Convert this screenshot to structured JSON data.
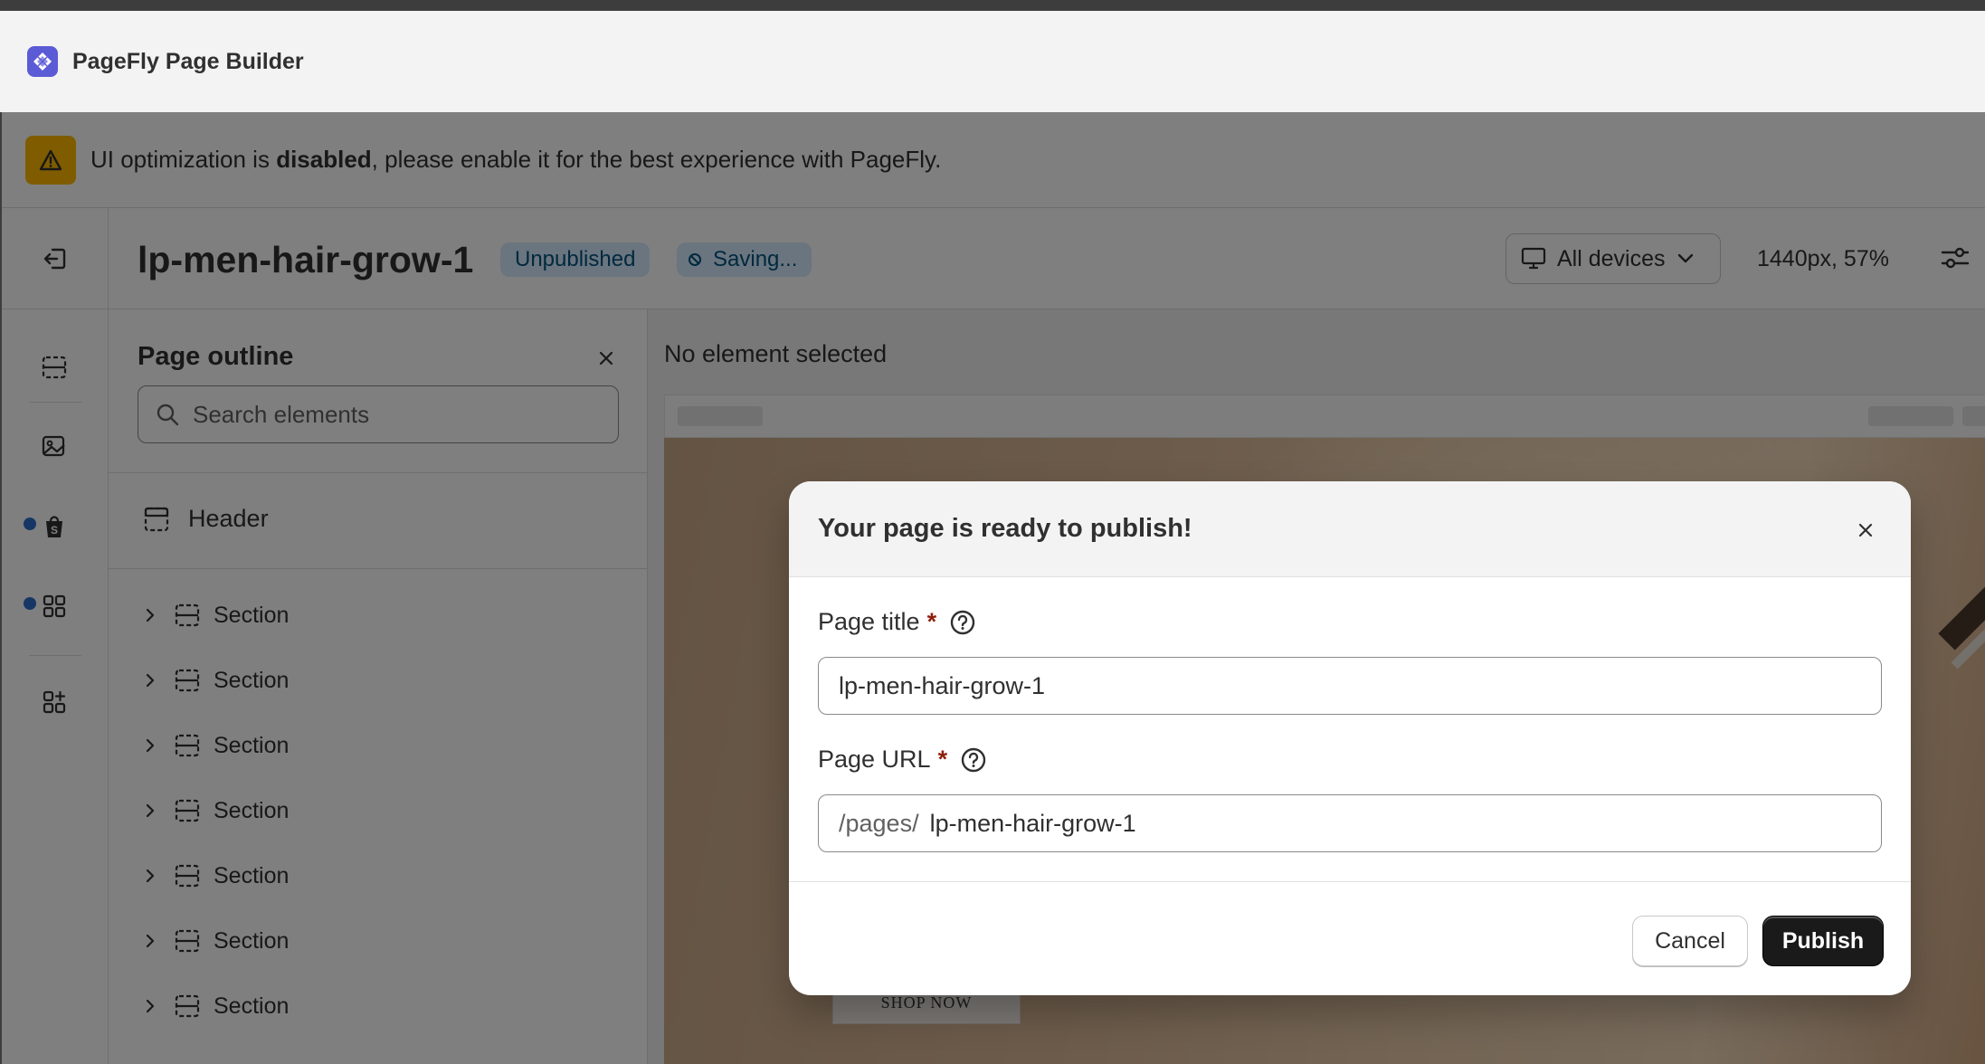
{
  "app": {
    "title": "PageFly Page Builder",
    "logo_icon": "pagefly-logo-icon"
  },
  "warning": {
    "text_before": "UI optimization is ",
    "text_bold": "disabled",
    "text_after": ", please enable it for the best experience with PageFly."
  },
  "header": {
    "page_name": "lp-men-hair-grow-1",
    "status_badge": "Unpublished",
    "saving_badge": "Saving...",
    "device_selector": "All devices",
    "zoom": "1440px, 57%"
  },
  "outline": {
    "title": "Page outline",
    "search_placeholder": "Search elements",
    "header_item": "Header",
    "sections": [
      "Section",
      "Section",
      "Section",
      "Section",
      "Section",
      "Section",
      "Section"
    ]
  },
  "canvas": {
    "no_selection": "No element selected",
    "shop_button": "SHOP NOW"
  },
  "modal": {
    "title": "Your page is ready to publish!",
    "page_title_label": "Page title",
    "page_title_value": "lp-men-hair-grow-1",
    "page_url_label": "Page URL",
    "page_url_prefix": "/pages/",
    "page_url_value": "lp-men-hair-grow-1",
    "required_marker": "*",
    "cancel_label": "Cancel",
    "publish_label": "Publish"
  },
  "colors": {
    "accent": "#5b5bd6",
    "warning": "#ffb800",
    "badge_bg": "#d5ebff",
    "primary_button": "#1a1a1a",
    "required": "#8e1f0b",
    "notification_dot": "#2c6ecb"
  }
}
